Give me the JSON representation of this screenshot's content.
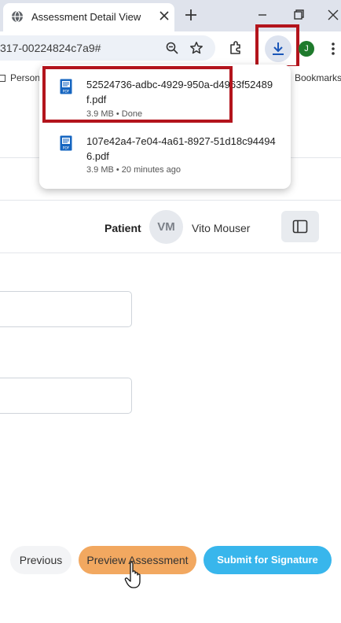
{
  "browser": {
    "tab_title": "Assessment Detail View",
    "url": "317-00224824c7a9#",
    "profile_initial": "J",
    "bookmarks_left": "Person",
    "bookmarks_right": "Bookmarks"
  },
  "downloads": {
    "items": [
      {
        "filename": "52524736-adbc-4929-950a-d4963f52489f.pdf",
        "meta": "3.9 MB • Done",
        "highlighted": true
      },
      {
        "filename": "107e42a4-7e04-4a61-8927-51d18c944946.pdf",
        "meta": "3.9 MB • 20 minutes ago",
        "highlighted": false
      }
    ]
  },
  "header": {
    "patient_label": "Patient",
    "patient_initials": "VM",
    "patient_name": "Vito Mouser"
  },
  "form": {
    "field1_value": "",
    "field2_value": ""
  },
  "actions": {
    "previous": "Previous",
    "preview": "Preview Assessment",
    "submit": "Submit for Signature"
  },
  "colors": {
    "accent_orange": "#f2a860",
    "accent_blue": "#38b6ec",
    "highlight_red": "#b3141c"
  }
}
